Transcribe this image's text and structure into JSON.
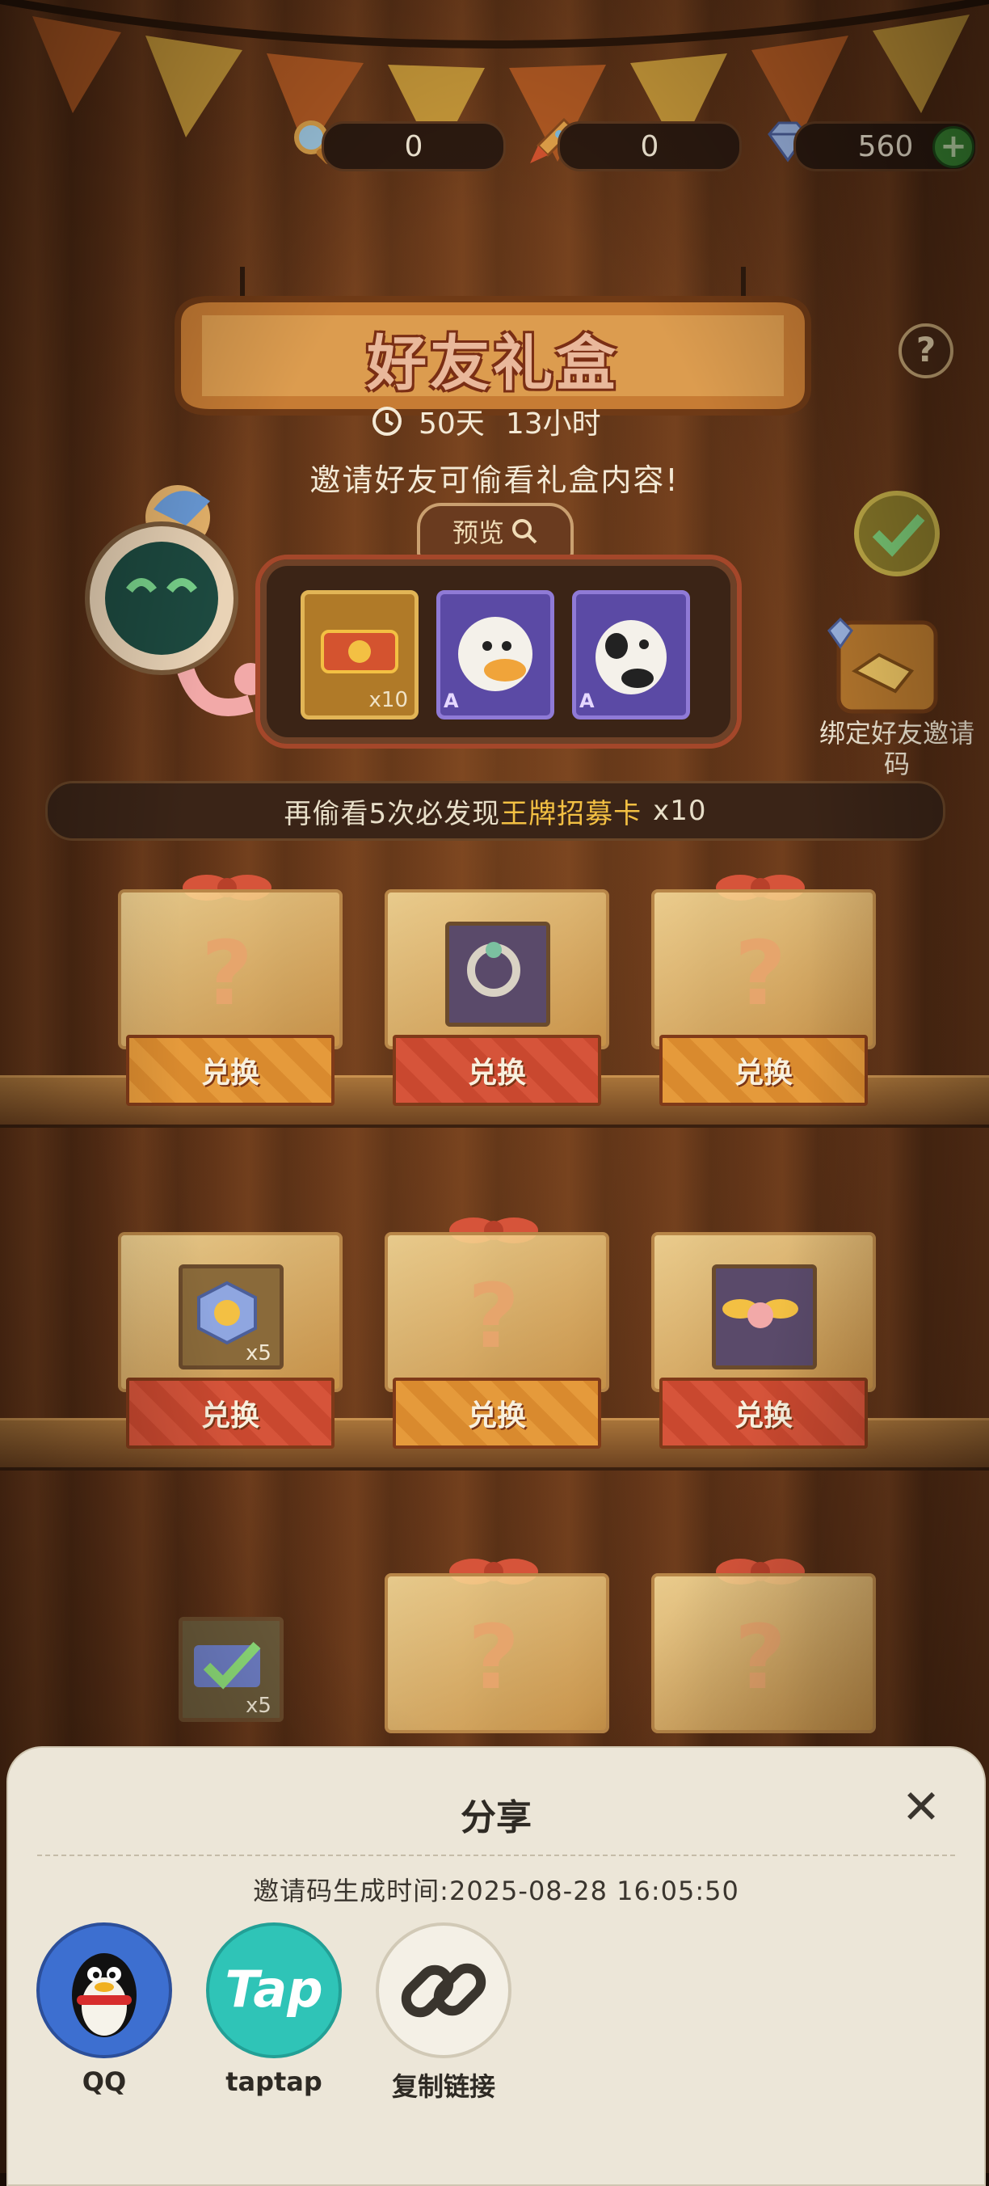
{
  "currency": {
    "magnifier": "0",
    "rocket": "0",
    "diamond": "560",
    "add_symbol": "+"
  },
  "header": {
    "title": "好友礼盒",
    "help_symbol": "?"
  },
  "timer": {
    "days": "50天",
    "hours": "13小时"
  },
  "invite_hint": "邀请好友可偷看礼盒内容!",
  "preview": {
    "tab_label": "预览",
    "items": [
      {
        "count": "x10"
      },
      {
        "rank": "A"
      },
      {
        "rank": "A"
      }
    ]
  },
  "bind_friend": {
    "label": "绑定好友邀请码"
  },
  "progress": {
    "prefix": "再偷看5次必发现",
    "highlight": "王牌招募卡",
    "suffix": "x10"
  },
  "boxes": {
    "row1": [
      {
        "label": "兑换"
      },
      {
        "label": "兑换"
      },
      {
        "label": "兑换"
      }
    ],
    "row2": [
      {
        "label": "兑换",
        "count": "x5"
      },
      {
        "label": "兑换"
      },
      {
        "label": "兑换"
      }
    ],
    "row3": [
      {
        "count": "x5"
      },
      {},
      {}
    ]
  },
  "share_sheet": {
    "title": "分享",
    "close_symbol": "✕",
    "time_text": "邀请码生成时间:2025-08-28  16:05:50",
    "options": [
      {
        "label": "QQ",
        "icon": "qq-penguin-icon"
      },
      {
        "label": "taptap",
        "icon": "taptap-icon",
        "icon_text": "Tap"
      },
      {
        "label": "复制链接",
        "icon": "link-icon"
      }
    ]
  },
  "colors": {
    "accent_orange": "#e59a3b",
    "accent_red": "#d6543a",
    "highlight": "#f3c043",
    "sheet_bg": "#ece6d8"
  }
}
